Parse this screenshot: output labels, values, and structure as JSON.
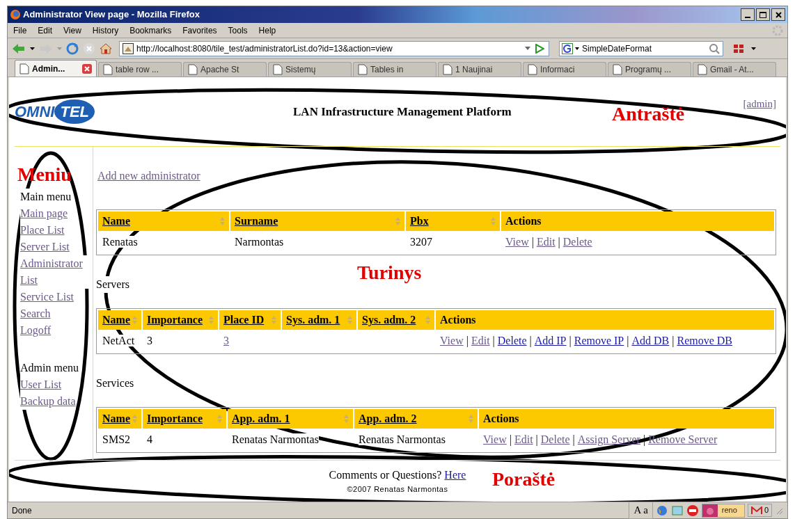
{
  "window": {
    "title": "Administrator View page - Mozilla Firefox"
  },
  "menu_bar": [
    "File",
    "Edit",
    "View",
    "History",
    "Bookmarks",
    "Favorites",
    "Tools",
    "Help"
  ],
  "address_bar": {
    "value": "http://localhost:8080/tile_test/administratorList.do?id=13&action=view"
  },
  "search_field": {
    "value": "SimpleDateFormat"
  },
  "tabs": [
    {
      "label": "Admin...",
      "selected": true
    },
    {
      "label": "table row ...",
      "selected": false
    },
    {
      "label": "Apache St",
      "selected": false
    },
    {
      "label": "Sistemų",
      "selected": false
    },
    {
      "label": "Tables in",
      "selected": false
    },
    {
      "label": "1 Naujinai",
      "selected": false
    },
    {
      "label": "Informaci",
      "selected": false
    },
    {
      "label": "Programų ...",
      "selected": false
    },
    {
      "label": "Gmail - At...",
      "selected": false
    }
  ],
  "page": {
    "header": {
      "logo": [
        "OMNI",
        "TEL"
      ],
      "title": "LAN Infrastructure Management Platform",
      "user_link": "[admin]"
    },
    "sidebar": [
      {
        "heading": "Main menu",
        "items": [
          "Main page",
          "Place List",
          "Server List",
          "Administrator List",
          "Service List",
          "Search",
          "Logoff"
        ]
      },
      {
        "heading": "Admin menu",
        "items": [
          "User List",
          "Backup data"
        ]
      }
    ],
    "content": {
      "add_link": "Add new administrator",
      "action_separator": "|",
      "tables": [
        {
          "columns": [
            {
              "label": "Name",
              "sortable": true
            },
            {
              "label": "Surname",
              "sortable": true
            },
            {
              "label": "Pbx",
              "sortable": true
            },
            {
              "label": "Actions",
              "sortable": false
            }
          ],
          "rows": [
            {
              "cells": [
                {
                  "kind": "text",
                  "text": "Renatas"
                },
                {
                  "kind": "text",
                  "text": "Narmontas"
                },
                {
                  "kind": "text",
                  "text": "3207"
                }
              ],
              "actions": [
                {
                  "label": "View",
                  "visited": true
                },
                {
                  "label": "Edit",
                  "visited": true
                },
                {
                  "label": "Delete",
                  "visited": true
                }
              ]
            }
          ]
        },
        {
          "caption": "Servers",
          "columns": [
            {
              "label": "Name",
              "sortable": true
            },
            {
              "label": "Importance",
              "sortable": true
            },
            {
              "label": "Place ID",
              "sortable": true
            },
            {
              "label": "Sys. adm. 1",
              "sortable": true
            },
            {
              "label": "Sys. adm. 2",
              "sortable": true
            },
            {
              "label": "Actions",
              "sortable": false
            }
          ],
          "rows": [
            {
              "cells": [
                {
                  "kind": "text",
                  "text": "NetAct"
                },
                {
                  "kind": "text",
                  "text": "3"
                },
                {
                  "kind": "link",
                  "text": "3"
                },
                {
                  "kind": "empty"
                },
                {
                  "kind": "empty"
                }
              ],
              "actions": [
                {
                  "label": "View",
                  "visited": true
                },
                {
                  "label": "Edit",
                  "visited": true
                },
                {
                  "label": "Delete",
                  "visited": false
                },
                {
                  "label": "Add IP",
                  "visited": false
                },
                {
                  "label": "Remove IP",
                  "visited": false
                },
                {
                  "label": "Add DB",
                  "visited": false
                },
                {
                  "label": "Remove DB",
                  "visited": false
                }
              ]
            }
          ]
        },
        {
          "caption": "Services",
          "columns": [
            {
              "label": "Name",
              "sortable": true
            },
            {
              "label": "Importance",
              "sortable": true
            },
            {
              "label": "App. adm. 1",
              "sortable": true
            },
            {
              "label": "App. adm. 2",
              "sortable": true
            },
            {
              "label": "Actions",
              "sortable": false
            }
          ],
          "rows": [
            {
              "cells": [
                {
                  "kind": "text",
                  "text": "SMS2"
                },
                {
                  "kind": "text",
                  "text": "4"
                },
                {
                  "kind": "text",
                  "text": "Renatas Narmontas"
                },
                {
                  "kind": "text",
                  "text": "Renatas Narmontas"
                }
              ],
              "actions": [
                {
                  "label": "View",
                  "visited": true
                },
                {
                  "label": "Edit",
                  "visited": true
                },
                {
                  "label": "Delete",
                  "visited": true
                },
                {
                  "label": "Assign Server",
                  "visited": true
                },
                {
                  "label": "Remove Server",
                  "visited": true
                }
              ]
            }
          ]
        }
      ]
    },
    "footer": {
      "text": "Comments or Questions?",
      "link": "Here",
      "copyright": "©2007 Renatas Narmontas"
    }
  },
  "status_bar": {
    "text": "Done",
    "font_button": "A a",
    "badge": "reno",
    "mail_count": "0"
  },
  "annotations": [
    "Antraštė",
    "Meniu",
    "Turinys",
    "Poraštė"
  ]
}
